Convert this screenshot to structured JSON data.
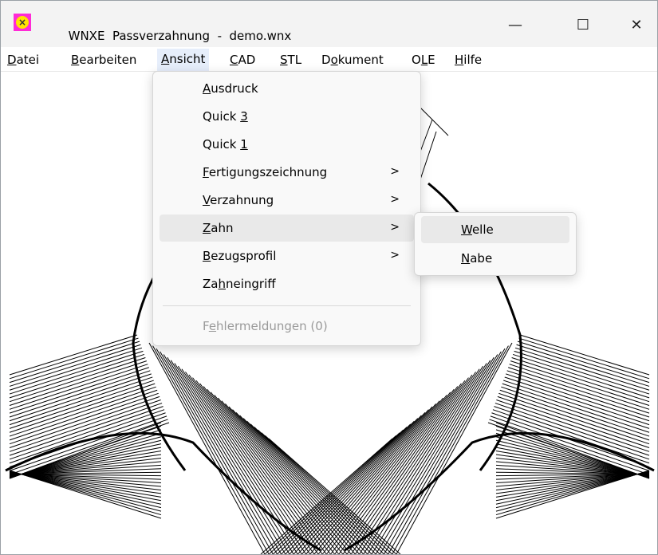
{
  "window": {
    "app_name": "WNXE",
    "title": "Passverzahnung  -  demo.wnx",
    "controls": {
      "minimize": "—",
      "maximize": "☐",
      "close": "✕"
    }
  },
  "menubar": [
    {
      "pre": "",
      "ul": "D",
      "post": "atei"
    },
    {
      "pre": "",
      "ul": "B",
      "post": "earbeiten"
    },
    {
      "pre": "",
      "ul": "A",
      "post": "nsicht"
    },
    {
      "pre": "",
      "ul": "C",
      "post": "AD"
    },
    {
      "pre": "",
      "ul": "S",
      "post": "TL"
    },
    {
      "pre": "D",
      "ul": "o",
      "post": "kument"
    },
    {
      "pre": "O",
      "ul": "L",
      "post": "E"
    },
    {
      "pre": "",
      "ul": "H",
      "post": "ilfe"
    }
  ],
  "dropdown": {
    "items": [
      {
        "pre": "",
        "ul": "A",
        "post": "usdruck",
        "arrow": ""
      },
      {
        "pre": "Quick ",
        "ul": "3",
        "post": "",
        "arrow": ""
      },
      {
        "pre": "Quick ",
        "ul": "1",
        "post": "",
        "arrow": ""
      },
      {
        "pre": "",
        "ul": "F",
        "post": "ertigungszeichnung",
        "arrow": ">"
      },
      {
        "pre": "",
        "ul": "V",
        "post": "erzahnung",
        "arrow": ">"
      },
      {
        "pre": "",
        "ul": "Z",
        "post": "ahn",
        "arrow": ">"
      },
      {
        "pre": "",
        "ul": "B",
        "post": "ezugsprofil",
        "arrow": ">"
      },
      {
        "pre": "Za",
        "ul": "h",
        "post": "neingriff",
        "arrow": ""
      },
      {
        "pre": "F",
        "ul": "e",
        "post": "hlermeldungen (0)",
        "arrow": ""
      }
    ]
  },
  "submenu": {
    "items": [
      {
        "pre": "",
        "ul": "W",
        "post": "elle"
      },
      {
        "pre": "",
        "ul": "N",
        "post": "abe"
      }
    ]
  },
  "colors": {
    "accent": "#e6eefb",
    "highlight": "#e9e9e9",
    "disabled": "#9a9a9a",
    "icon_bg": "#ff2bd6",
    "icon_sun": "#ffe400"
  },
  "icons": {
    "app": "wnxe-app-icon",
    "chevron": "chevron-right-icon"
  }
}
